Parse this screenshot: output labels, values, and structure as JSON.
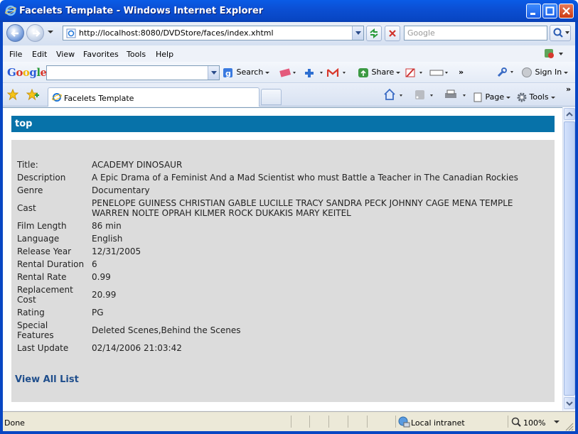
{
  "window": {
    "title": "Facelets Template - Windows Internet Explorer"
  },
  "address_bar": {
    "url": "http://localhost:8080/DVDStore/faces/index.xhtml",
    "search_placeholder": "Google"
  },
  "menu": {
    "items": [
      "File",
      "Edit",
      "View",
      "Favorites",
      "Tools",
      "Help"
    ]
  },
  "google_toolbar": {
    "logo": "Google",
    "search_label": "Search",
    "share_label": "Share",
    "sign_in_label": "Sign In"
  },
  "tabs": {
    "active_label": "Facelets Template"
  },
  "command_bar": {
    "page_label": "Page",
    "tools_label": "Tools"
  },
  "page": {
    "top_label": "top",
    "fields": [
      {
        "label": "Title:",
        "value": "ACADEMY DINOSAUR"
      },
      {
        "label": "Description",
        "value": "A Epic Drama of a Feminist And a Mad Scientist who must Battle a Teacher in The Canadian Rockies"
      },
      {
        "label": "Genre",
        "value": "Documentary"
      },
      {
        "label": "Cast",
        "value": "PENELOPE GUINESS CHRISTIAN GABLE LUCILLE TRACY SANDRA PECK JOHNNY CAGE MENA TEMPLE WARREN NOLTE OPRAH KILMER ROCK DUKAKIS MARY KEITEL"
      },
      {
        "label": "Film Length",
        "value": "86 min"
      },
      {
        "label": "Language",
        "value": "English"
      },
      {
        "label": "Release Year",
        "value": "12/31/2005"
      },
      {
        "label": "Rental Duration",
        "value": "6"
      },
      {
        "label": "Rental Rate",
        "value": "0.99"
      },
      {
        "label": "Replacement Cost",
        "value": "20.99"
      },
      {
        "label": "Rating",
        "value": "PG"
      },
      {
        "label": "Special Features",
        "value": "Deleted Scenes,Behind the Scenes"
      },
      {
        "label": "Last Update",
        "value": "02/14/2006 21:03:42"
      }
    ],
    "view_all_link": "View All List"
  },
  "status_bar": {
    "status_text": "Done",
    "zone": "Local intranet",
    "zoom": "100%"
  },
  "colors": {
    "top_band": "#0772a9",
    "panel_bg": "#dcdcdc",
    "link": "#1f4e8c"
  }
}
